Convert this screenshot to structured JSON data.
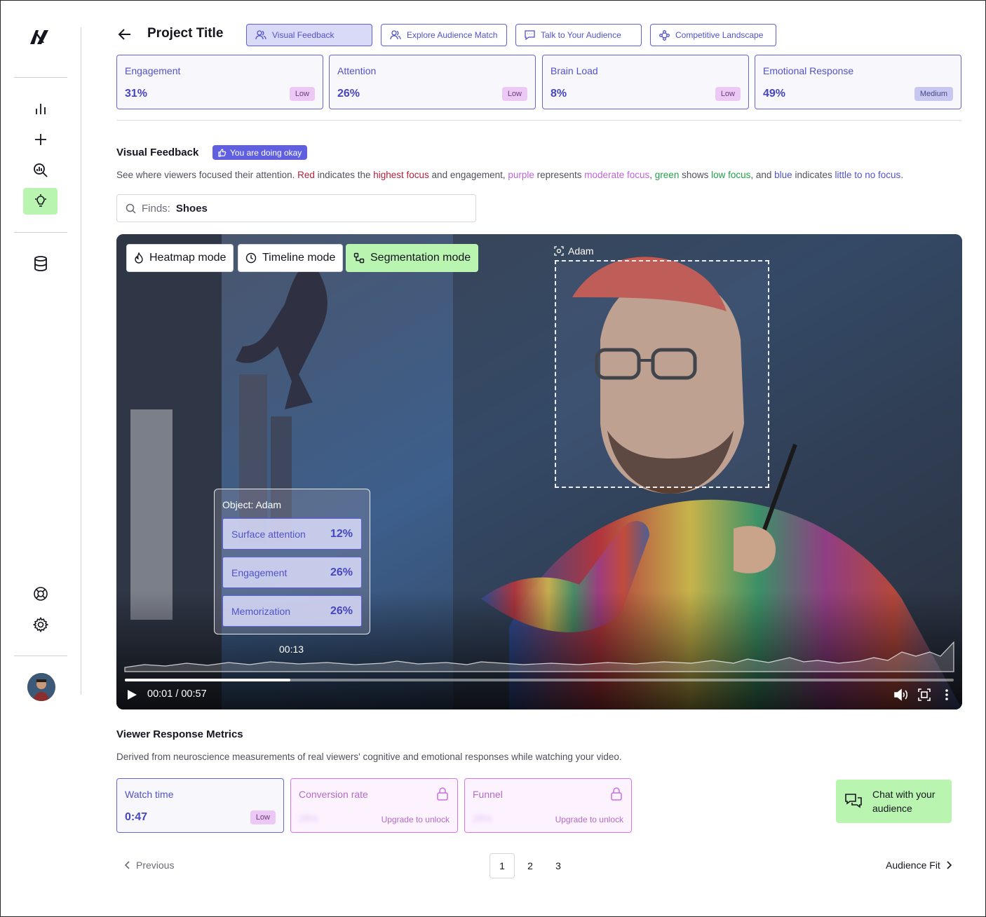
{
  "header": {
    "title": "Project Title",
    "tabs": [
      {
        "label": "Visual Feedback",
        "icon": "users-icon",
        "active": true
      },
      {
        "label": "Explore Audience Match",
        "icon": "users-icon",
        "active": false
      },
      {
        "label": "Talk to Your Audience",
        "icon": "chat-icon",
        "active": false
      },
      {
        "label": "Competitive Landscape",
        "icon": "network-icon",
        "active": false
      }
    ]
  },
  "metrics": [
    {
      "label": "Engagement",
      "value": "31%",
      "badge": "Low"
    },
    {
      "label": "Attention",
      "value": "26%",
      "badge": "Low"
    },
    {
      "label": "Brain Load",
      "value": "8%",
      "badge": "Low"
    },
    {
      "label": "Emotional Response",
      "value": "49%",
      "badge": "Medium"
    }
  ],
  "visual_feedback": {
    "title": "Visual Feedback",
    "status_badge": "You are doing okay",
    "description": {
      "p1": "See where viewers focused their attention. ",
      "red": "Red",
      "p2": " indicates the ",
      "red_focus": "highest focus",
      "p3": " and engagement, ",
      "purple": "purple",
      "p4": " represents ",
      "purple_focus": "moderate focus",
      "p5": ", ",
      "green": "green",
      "p6": " shows ",
      "green_focus": "low focus",
      "p7": ", and ",
      "blue": "blue",
      "p8": " indicates ",
      "blue_focus": "little to no focus",
      "p9": "."
    },
    "search": {
      "label": "Finds:",
      "value": "Shoes"
    }
  },
  "video": {
    "modes": [
      {
        "label": "Heatmap mode",
        "icon": "flame-icon",
        "active": false
      },
      {
        "label": "Timeline mode",
        "icon": "clock-icon",
        "active": false
      },
      {
        "label": "Segmentation mode",
        "icon": "segment-icon",
        "active": true
      }
    ],
    "segment_label": "Adam",
    "object_panel": {
      "title": "Object: Adam",
      "rows": [
        {
          "label": "Surface attention",
          "value": "12%"
        },
        {
          "label": "Engagement",
          "value": "26%"
        },
        {
          "label": "Memorization",
          "value": "26%"
        }
      ]
    },
    "hover_time": "00:13",
    "current_time": "00:01 / 00:57",
    "progress": 0.2
  },
  "viewer_metrics": {
    "title": "Viewer Response Metrics",
    "description": "Derived from neuroscience measurements of real viewers' cognitive and emotional responses while watching your video.",
    "cards": [
      {
        "label": "Watch time",
        "value": "0:47",
        "badge": "Low"
      },
      {
        "label": "Conversion rate",
        "value": "28%",
        "action": "Upgrade to unlock"
      },
      {
        "label": "Funnel",
        "value": "28%",
        "action": "Upgrade to unlock"
      }
    ]
  },
  "chat": {
    "label": "Chat with your audience"
  },
  "pagination": {
    "previous": "Previous",
    "pages": [
      "1",
      "2",
      "3"
    ],
    "current": "1",
    "next": "Audience Fit"
  },
  "colors": {
    "accent": "#5f5fe0",
    "green": "#b9f5b0",
    "locked": "#d676ea"
  }
}
